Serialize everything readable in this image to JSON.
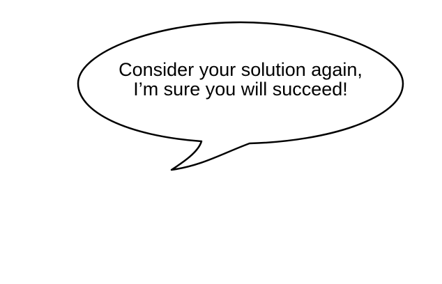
{
  "speech_bubble": {
    "line1": "Consider your solution again,",
    "line2": "I’m sure you will succeed!",
    "fill_color": "#ffffff",
    "stroke_color": "#000000"
  }
}
